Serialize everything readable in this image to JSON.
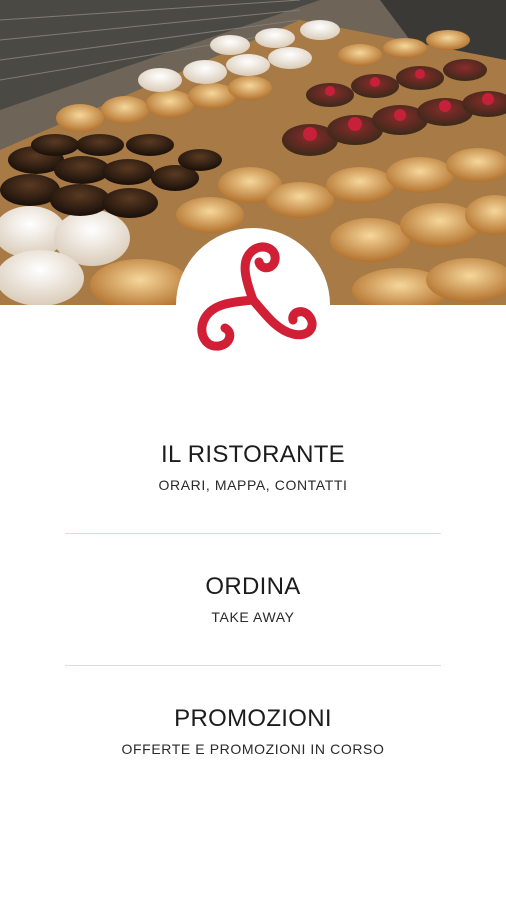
{
  "hero": {
    "image": "pastry-display-photo",
    "logo": "triskelion-logo"
  },
  "colors": {
    "brand_red": "#d11f35",
    "divider": "#f2d3d6"
  },
  "menu": {
    "items": [
      {
        "title": "IL RISTORANTE",
        "subtitle": "ORARI, MAPPA, CONTATTI"
      },
      {
        "title": "ORDINA",
        "subtitle": "TAKE AWAY"
      },
      {
        "title": "PROMOZIONI",
        "subtitle": "OFFERTE E PROMOZIONI IN CORSO"
      }
    ]
  }
}
